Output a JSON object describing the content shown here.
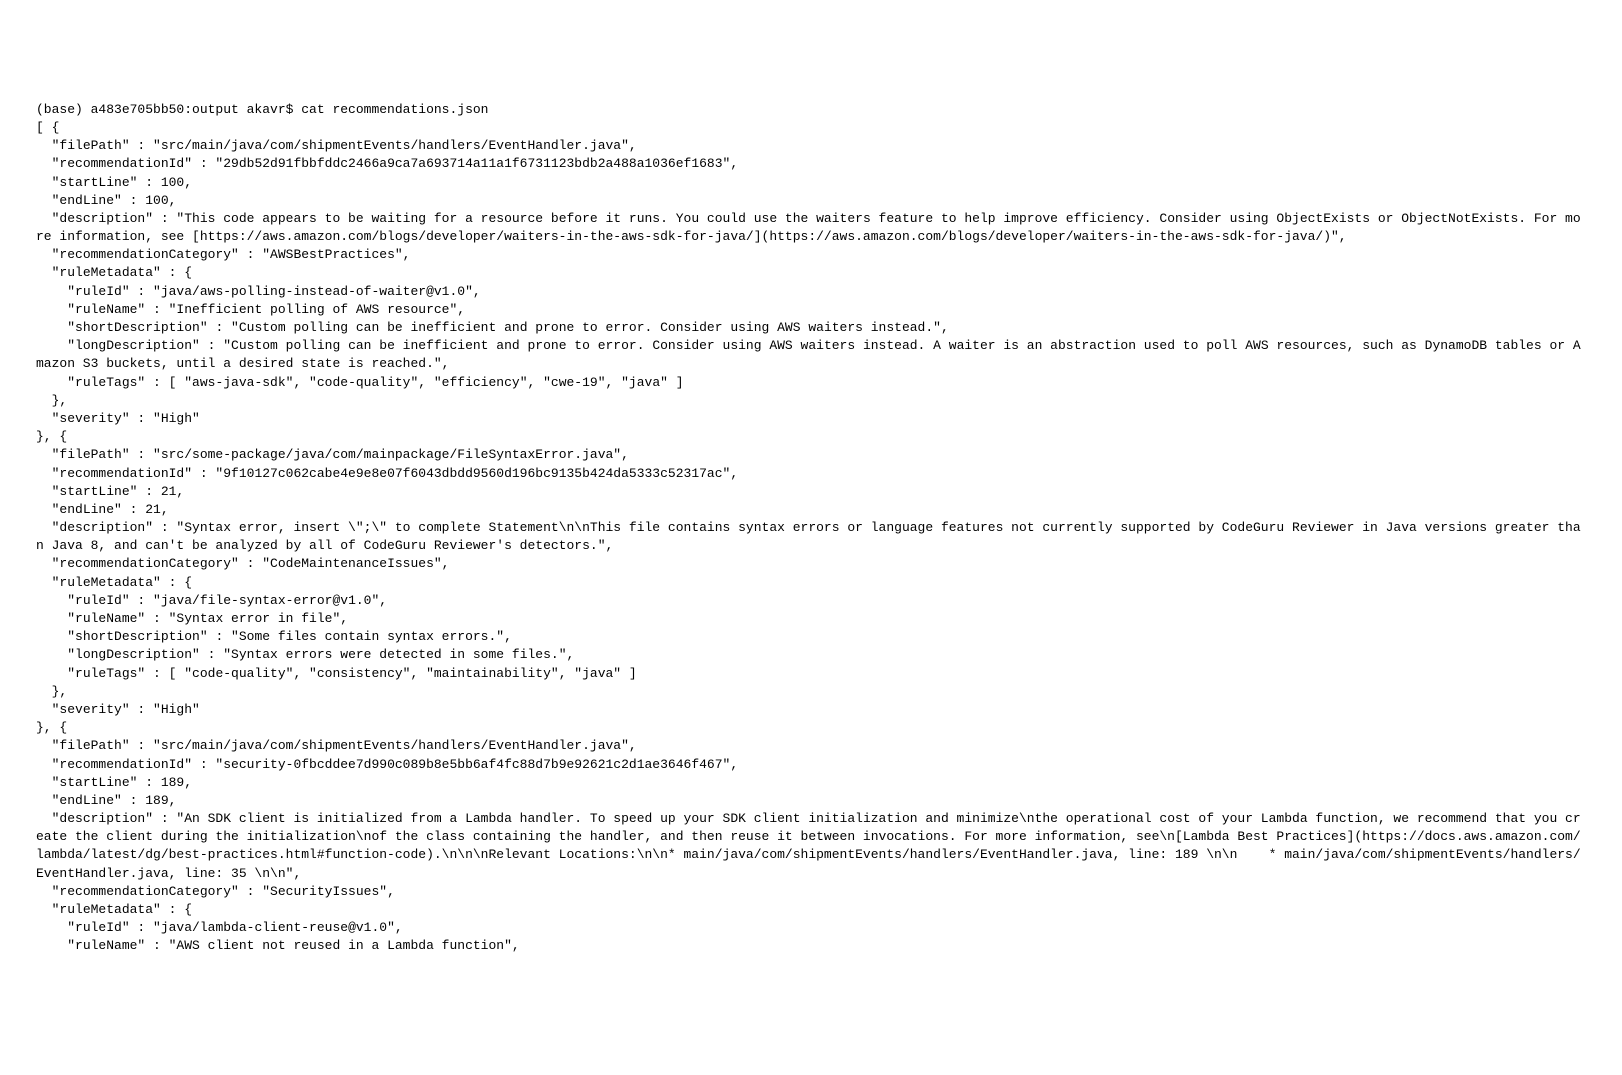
{
  "prompt": "(base) a483e705bb50:output akavr$ cat recommendations.json",
  "lines": [
    "[ {",
    "  \"filePath\" : \"src/main/java/com/shipmentEvents/handlers/EventHandler.java\",",
    "  \"recommendationId\" : \"29db52d91fbbfddc2466a9ca7a693714a11a1f6731123bdb2a488a1036ef1683\",",
    "  \"startLine\" : 100,",
    "  \"endLine\" : 100,",
    "  \"description\" : \"This code appears to be waiting for a resource before it runs. You could use the waiters feature to help improve efficiency. Consider using ObjectExists or ObjectNotExists. For more information, see [https://aws.amazon.com/blogs/developer/waiters-in-the-aws-sdk-for-java/](https://aws.amazon.com/blogs/developer/waiters-in-the-aws-sdk-for-java/)\",",
    "  \"recommendationCategory\" : \"AWSBestPractices\",",
    "  \"ruleMetadata\" : {",
    "    \"ruleId\" : \"java/aws-polling-instead-of-waiter@v1.0\",",
    "    \"ruleName\" : \"Inefficient polling of AWS resource\",",
    "    \"shortDescription\" : \"Custom polling can be inefficient and prone to error. Consider using AWS waiters instead.\",",
    "    \"longDescription\" : \"Custom polling can be inefficient and prone to error. Consider using AWS waiters instead. A waiter is an abstraction used to poll AWS resources, such as DynamoDB tables or Amazon S3 buckets, until a desired state is reached.\",",
    "    \"ruleTags\" : [ \"aws-java-sdk\", \"code-quality\", \"efficiency\", \"cwe-19\", \"java\" ]",
    "  },",
    "  \"severity\" : \"High\"",
    "}, {",
    "  \"filePath\" : \"src/some-package/java/com/mainpackage/FileSyntaxError.java\",",
    "  \"recommendationId\" : \"9f10127c062cabe4e9e8e07f6043dbdd9560d196bc9135b424da5333c52317ac\",",
    "  \"startLine\" : 21,",
    "  \"endLine\" : 21,",
    "  \"description\" : \"Syntax error, insert \\\";\\\" to complete Statement\\n\\nThis file contains syntax errors or language features not currently supported by CodeGuru Reviewer in Java versions greater than Java 8, and can't be analyzed by all of CodeGuru Reviewer's detectors.\",",
    "  \"recommendationCategory\" : \"CodeMaintenanceIssues\",",
    "  \"ruleMetadata\" : {",
    "    \"ruleId\" : \"java/file-syntax-error@v1.0\",",
    "    \"ruleName\" : \"Syntax error in file\",",
    "    \"shortDescription\" : \"Some files contain syntax errors.\",",
    "    \"longDescription\" : \"Syntax errors were detected in some files.\",",
    "    \"ruleTags\" : [ \"code-quality\", \"consistency\", \"maintainability\", \"java\" ]",
    "  },",
    "  \"severity\" : \"High\"",
    "}, {",
    "  \"filePath\" : \"src/main/java/com/shipmentEvents/handlers/EventHandler.java\",",
    "  \"recommendationId\" : \"security-0fbcddee7d990c089b8e5bb6af4fc88d7b9e92621c2d1ae3646f467\",",
    "  \"startLine\" : 189,",
    "  \"endLine\" : 189,",
    "  \"description\" : \"An SDK client is initialized from a Lambda handler. To speed up your SDK client initialization and minimize\\nthe operational cost of your Lambda function, we recommend that you create the client during the initialization\\nof the class containing the handler, and then reuse it between invocations. For more information, see\\n[Lambda Best Practices](https://docs.aws.amazon.com/lambda/latest/dg/best-practices.html#function-code).\\n\\n\\nRelevant Locations:\\n\\n* main/java/com/shipmentEvents/handlers/EventHandler.java, line: 189 \\n\\n    * main/java/com/shipmentEvents/handlers/EventHandler.java, line: 35 \\n\\n\",",
    "  \"recommendationCategory\" : \"SecurityIssues\",",
    "  \"ruleMetadata\" : {",
    "    \"ruleId\" : \"java/lambda-client-reuse@v1.0\",",
    "    \"ruleName\" : \"AWS client not reused in a Lambda function\","
  ]
}
